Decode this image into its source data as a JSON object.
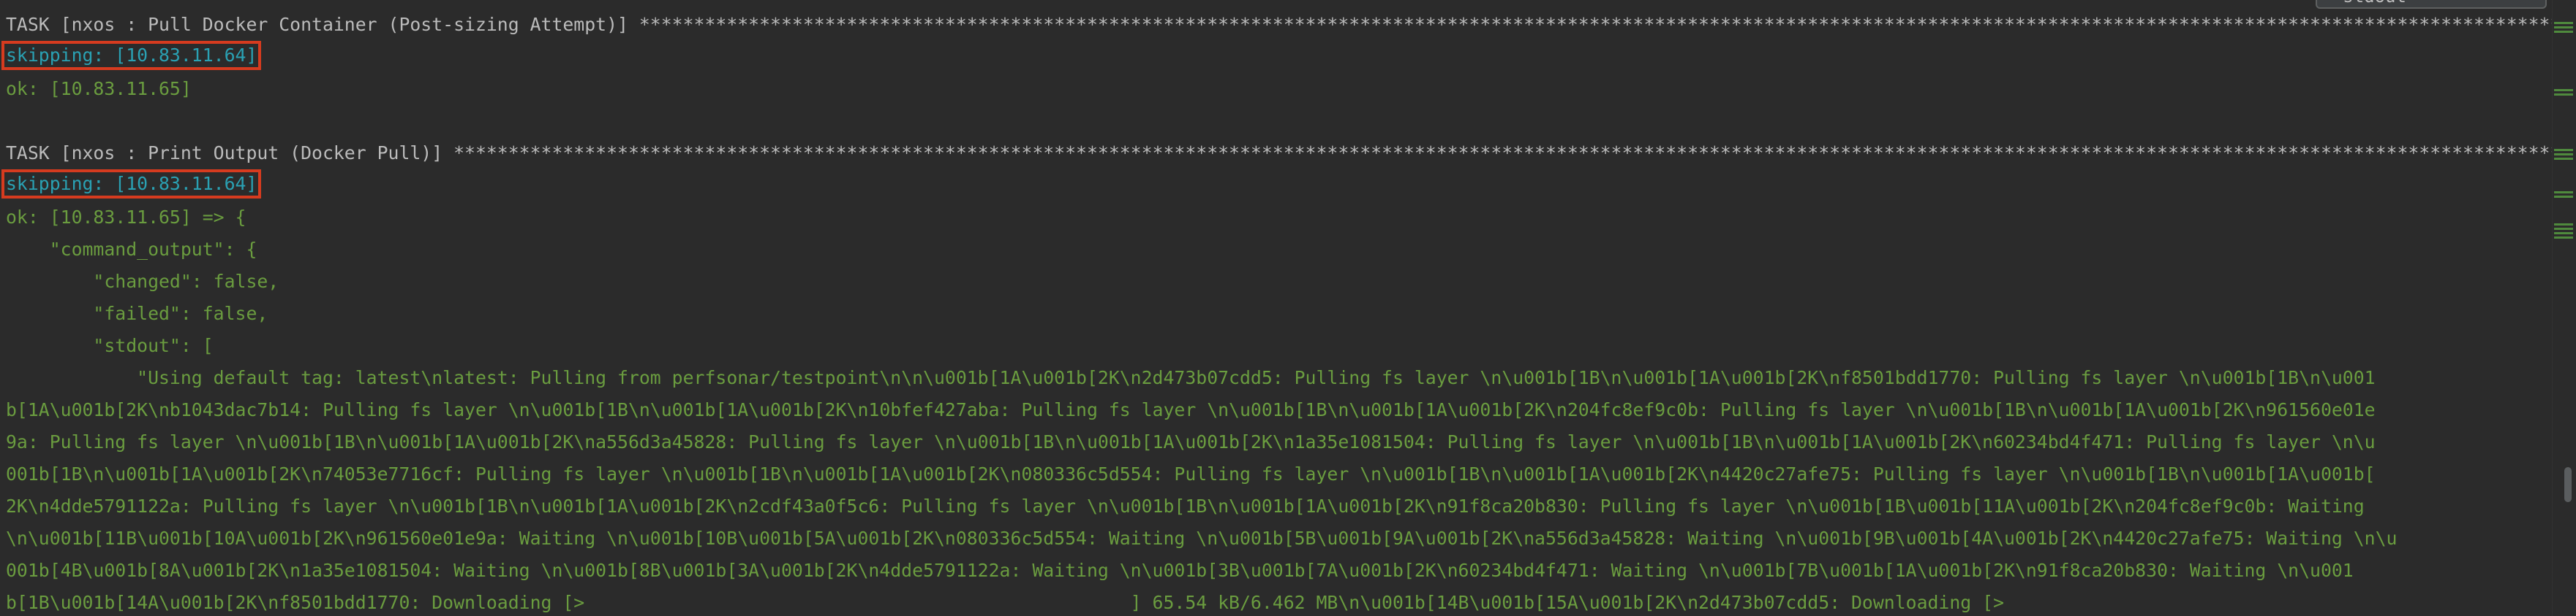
{
  "search": {
    "value": "stdout",
    "icon": "search-icon"
  },
  "lines": {
    "task1": "TASK [nxos : Pull Docker Container (Post-sizing Attempt)] ********************************************************************************************************************************************************************************************************************************************************",
    "skip1": "skipping: [10.83.11.64]",
    "ok1": "ok: [10.83.11.65]",
    "task2": "TASK [nxos : Print Output (Docker Pull)] ****************************************************************************************************************************************************************************************************************************************************************************",
    "skip2": "skipping: [10.83.11.64]",
    "ok2": "ok: [10.83.11.65] => {",
    "j1": "    \"command_output\": {",
    "j2": "        \"changed\": false,",
    "j3": "        \"failed\": false,",
    "j4": "        \"stdout\": [",
    "s1": "            \"Using default tag: latest\\nlatest: Pulling from perfsonar/testpoint\\n\\n\\u001b[1A\\u001b[2K\\n2d473b07cdd5: Pulling fs layer \\n\\u001b[1B\\n\\u001b[1A\\u001b[2K\\nf8501bdd1770: Pulling fs layer \\n\\u001b[1B\\n\\u001",
    "s2": "b[1A\\u001b[2K\\nb1043dac7b14: Pulling fs layer \\n\\u001b[1B\\n\\u001b[1A\\u001b[2K\\n10bfef427aba: Pulling fs layer \\n\\u001b[1B\\n\\u001b[1A\\u001b[2K\\n204fc8ef9c0b: Pulling fs layer \\n\\u001b[1B\\n\\u001b[1A\\u001b[2K\\n961560e01e",
    "s3": "9a: Pulling fs layer \\n\\u001b[1B\\n\\u001b[1A\\u001b[2K\\na556d3a45828: Pulling fs layer \\n\\u001b[1B\\n\\u001b[1A\\u001b[2K\\n1a35e1081504: Pulling fs layer \\n\\u001b[1B\\n\\u001b[1A\\u001b[2K\\n60234bd4f471: Pulling fs layer \\n\\u",
    "s4": "001b[1B\\n\\u001b[1A\\u001b[2K\\n74053e7716cf: Pulling fs layer \\n\\u001b[1B\\n\\u001b[1A\\u001b[2K\\n080336c5d554: Pulling fs layer \\n\\u001b[1B\\n\\u001b[1A\\u001b[2K\\n4420c27afe75: Pulling fs layer \\n\\u001b[1B\\n\\u001b[1A\\u001b[",
    "s5": "2K\\n4dde5791122a: Pulling fs layer \\n\\u001b[1B\\n\\u001b[1A\\u001b[2K\\n2cdf43a0f5c6: Pulling fs layer \\n\\u001b[1B\\n\\u001b[1A\\u001b[2K\\n91f8ca20b830: Pulling fs layer \\n\\u001b[1B\\u001b[11A\\u001b[2K\\n204fc8ef9c0b: Waiting",
    "s6": "\\n\\u001b[11B\\u001b[10A\\u001b[2K\\n961560e01e9a: Waiting \\n\\u001b[10B\\u001b[5A\\u001b[2K\\n080336c5d554: Waiting \\n\\u001b[5B\\u001b[9A\\u001b[2K\\na556d3a45828: Waiting \\n\\u001b[9B\\u001b[4A\\u001b[2K\\n4420c27afe75: Waiting \\n\\u",
    "s7": "001b[4B\\u001b[8A\\u001b[2K\\n1a35e1081504: Waiting \\n\\u001b[8B\\u001b[3A\\u001b[2K\\n4dde5791122a: Waiting \\n\\u001b[3B\\u001b[7A\\u001b[2K\\n60234bd4f471: Waiting \\n\\u001b[7B\\u001b[1A\\u001b[2K\\n91f8ca20b830: Waiting \\n\\u001",
    "s8": "b[1B\\u001b[14A\\u001b[2K\\nf8501bdd1770: Downloading [>                                                  ] 65.54 kB/6.462 MB\\n\\u001b[14B\\u001b[15A\\u001b[2K\\n2d473b07cdd5: Downloading [>"
  },
  "colors": {
    "background": "#2b2b2b",
    "task_text": "#bbbbbb",
    "ok_text": "#6a9c3f",
    "skip_text": "#2aa1b3",
    "highlight_border": "#d63b1f"
  }
}
